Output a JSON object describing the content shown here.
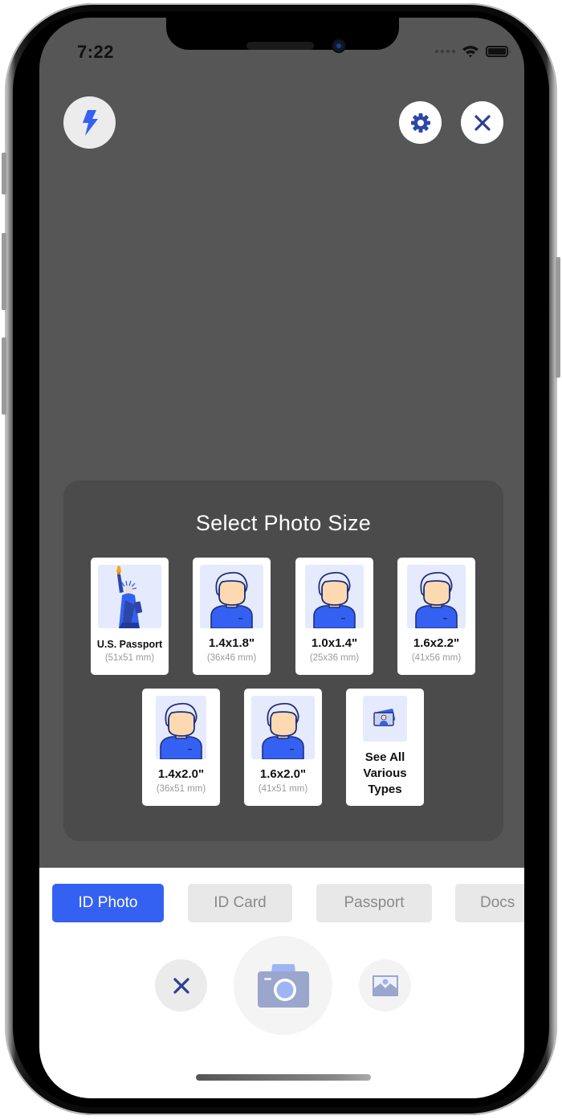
{
  "status_bar": {
    "time": "7:22",
    "icons": [
      "cellular-signal-icon",
      "wifi-icon",
      "battery-icon"
    ]
  },
  "top_controls": {
    "flash": {
      "icon": "flash-icon",
      "color": "#3461f2"
    },
    "settings": {
      "icon": "gear-icon",
      "color": "#2d47a8"
    },
    "close": {
      "icon": "close-icon",
      "color": "#2d3f8f"
    }
  },
  "panel": {
    "title": "Select Photo Size",
    "sizes": [
      {
        "label": "U.S. Passport",
        "mm": "(51x51 mm)",
        "icon": "statue-of-liberty-icon"
      },
      {
        "label": "1.4x1.8\"",
        "mm": "(36x46 mm)",
        "icon": "person-portrait-icon"
      },
      {
        "label": "1.0x1.4\"",
        "mm": "(25x36 mm)",
        "icon": "person-portrait-icon"
      },
      {
        "label": "1.6x2.2\"",
        "mm": "(41x56 mm)",
        "icon": "person-portrait-icon"
      },
      {
        "label": "1.4x2.0\"",
        "mm": "(36x51 mm)",
        "icon": "person-portrait-icon"
      },
      {
        "label": "1.6x2.0\"",
        "mm": "(41x51 mm)",
        "icon": "person-portrait-icon"
      }
    ],
    "see_all": {
      "lines": [
        "See All",
        "Various",
        "Types"
      ],
      "icon": "id-cards-icon"
    }
  },
  "mode_tabs": [
    {
      "label": "ID Photo",
      "active": true
    },
    {
      "label": "ID Card",
      "active": false
    },
    {
      "label": "Passport",
      "active": false
    },
    {
      "label": "Docs",
      "active": false
    }
  ],
  "bottom_controls": {
    "cancel": {
      "icon": "close-icon"
    },
    "shutter": {
      "icon": "camera-icon"
    },
    "gallery": {
      "icon": "image-gallery-icon"
    }
  },
  "colors": {
    "accent": "#3461f2",
    "camera_bg": "#565656",
    "panel_bg": "#4b4b4b"
  }
}
